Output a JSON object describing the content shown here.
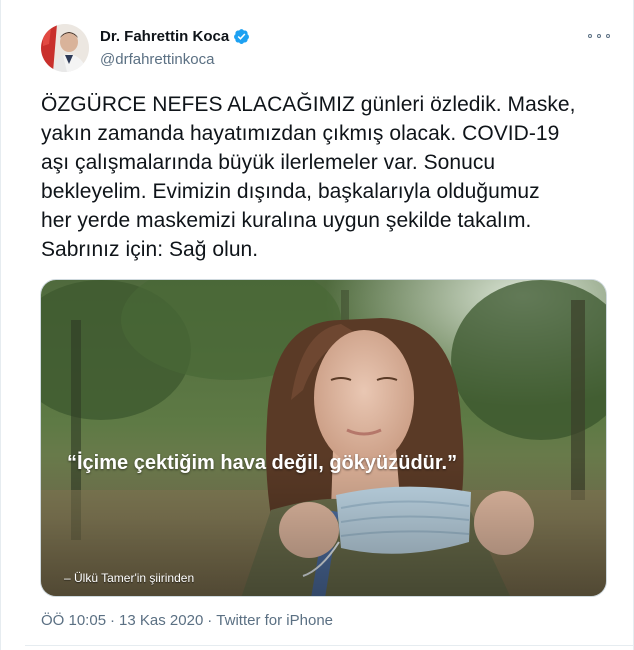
{
  "author": {
    "name": "Dr. Fahrettin Koca",
    "handle": "@drfahrettinkoca",
    "verified": true,
    "icons": {
      "verified": "verified-badge-icon",
      "more": "more-options-icon"
    }
  },
  "tweet": {
    "lines": [
      "ÖZGÜRCE NEFES ALACAĞIMIZ günleri özledik. Maske,",
      "yakın zamanda hayatımızdan çıkmış olacak. COVID-19",
      "aşı çalışmalarında büyük ilerlemeler var. Sonucu",
      "bekleyelim. Evimizin dışında, başkalarıyla olduğumuz",
      "her yerde maskemizi kuralına uygun şekilde takalım.",
      "Sabrınız için: Sağ olun."
    ]
  },
  "media": {
    "quote": "“İçime çektiğim hava değil, gökyüzüdür.”",
    "credit": "– Ülkü Tamer'in şiirinden"
  },
  "meta": {
    "time": "ÖÖ 10:05",
    "separator1": "·",
    "date": "13 Kas 2020",
    "separator2": "·",
    "source": "Twitter for iPhone"
  },
  "colors": {
    "text": "#0f1419",
    "secondary": "#5b7083",
    "verified": "#1da1f2",
    "border": "#e6ecf0"
  }
}
